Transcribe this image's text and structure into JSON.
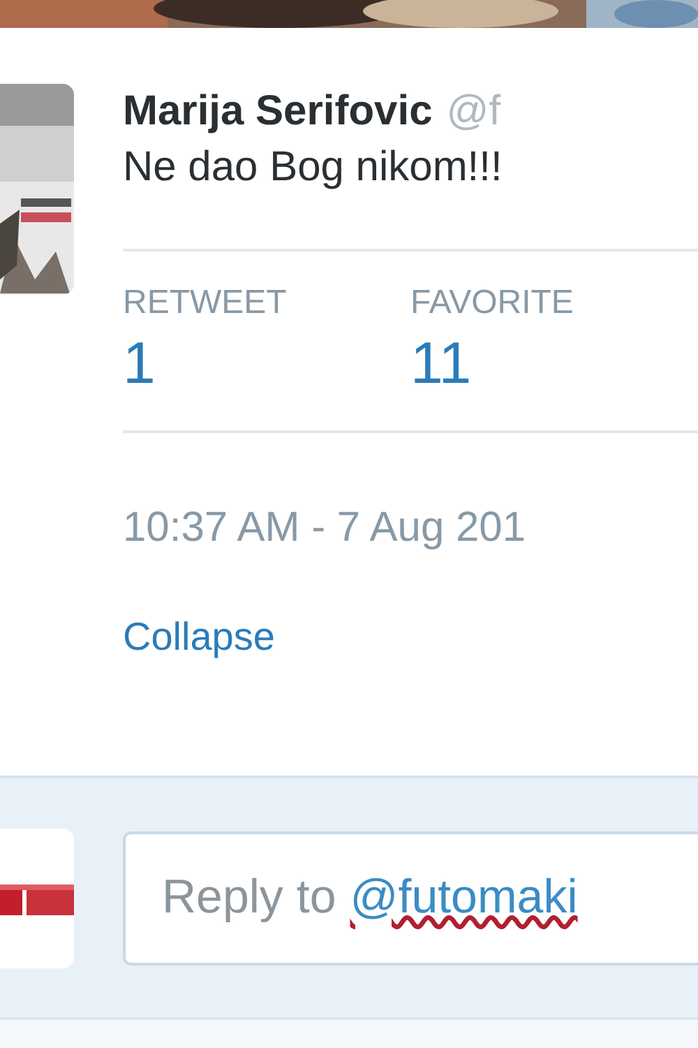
{
  "tweet": {
    "name": "Marija Serifovic",
    "handle": "@f",
    "text": "Ne dao Bog nikom!!!",
    "stats": [
      {
        "label": "RETWEET",
        "count": "1"
      },
      {
        "label": "FAVORITE",
        "count": "11"
      }
    ],
    "timestamp": "10:37 AM - 7 Aug 201",
    "collapse_link": "Collapse"
  },
  "reply": {
    "prefix": "Reply to",
    "mention": "@futomaki"
  }
}
